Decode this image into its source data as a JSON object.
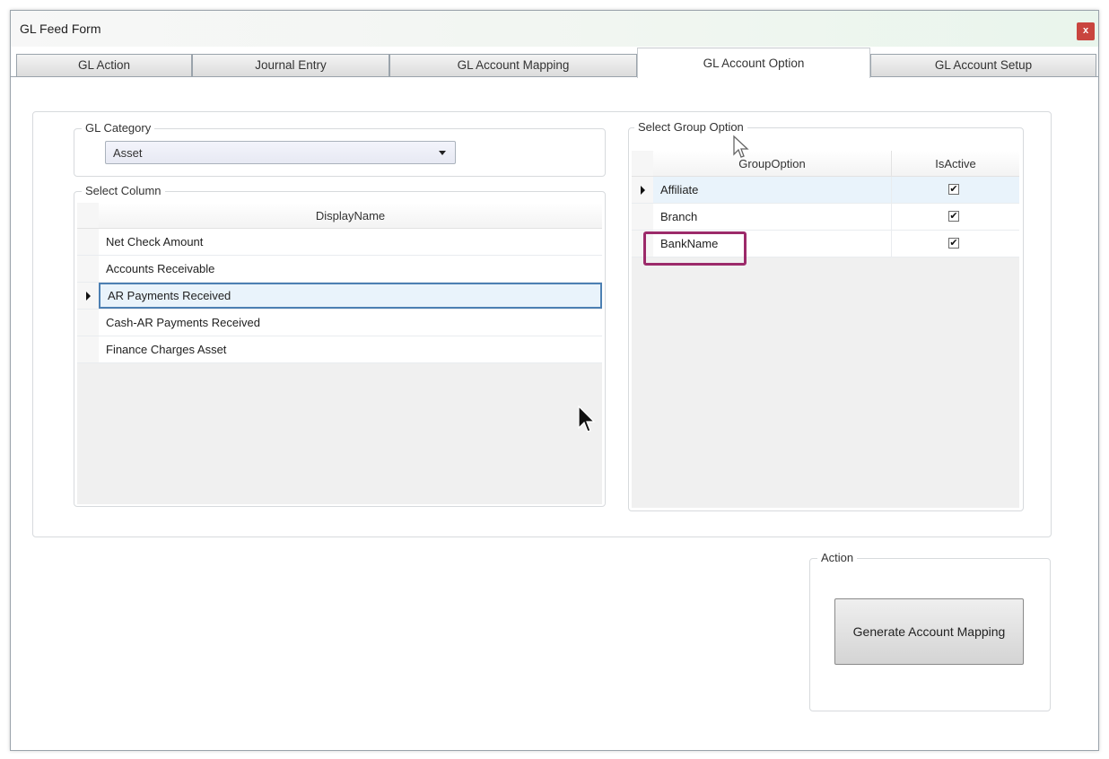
{
  "window": {
    "title": "GL Feed Form",
    "close_label": "x"
  },
  "tabs": [
    {
      "label": "GL Action",
      "active": false
    },
    {
      "label": "Journal Entry",
      "active": false
    },
    {
      "label": "GL Account Mapping",
      "active": false
    },
    {
      "label": "GL Account Option",
      "active": true
    },
    {
      "label": "GL Account Setup",
      "active": false
    }
  ],
  "gl_category": {
    "legend": "GL Category",
    "selected": "Asset"
  },
  "select_column": {
    "legend": "Select Column",
    "header": "DisplayName",
    "rows": [
      "Net Check Amount",
      "Accounts Receivable",
      "AR Payments Received",
      "Cash-AR Payments Received",
      "Finance Charges Asset"
    ],
    "current_row": "AR Payments Received"
  },
  "group_option": {
    "legend": "Select Group Option",
    "headers": {
      "option": "GroupOption",
      "active": "IsActive"
    },
    "rows": [
      {
        "name": "Affiliate",
        "active": true
      },
      {
        "name": "Branch",
        "active": true
      },
      {
        "name": "BankName",
        "active": true
      }
    ],
    "current_row": "Affiliate",
    "highlighted_row": "BankName",
    "check_glyph": "✔"
  },
  "action": {
    "legend": "Action",
    "button_label": "Generate Account Mapping"
  },
  "colors": {
    "highlight": "#9c2a6a",
    "selection": "#e9f3fb",
    "close_button": "#c9453f"
  }
}
